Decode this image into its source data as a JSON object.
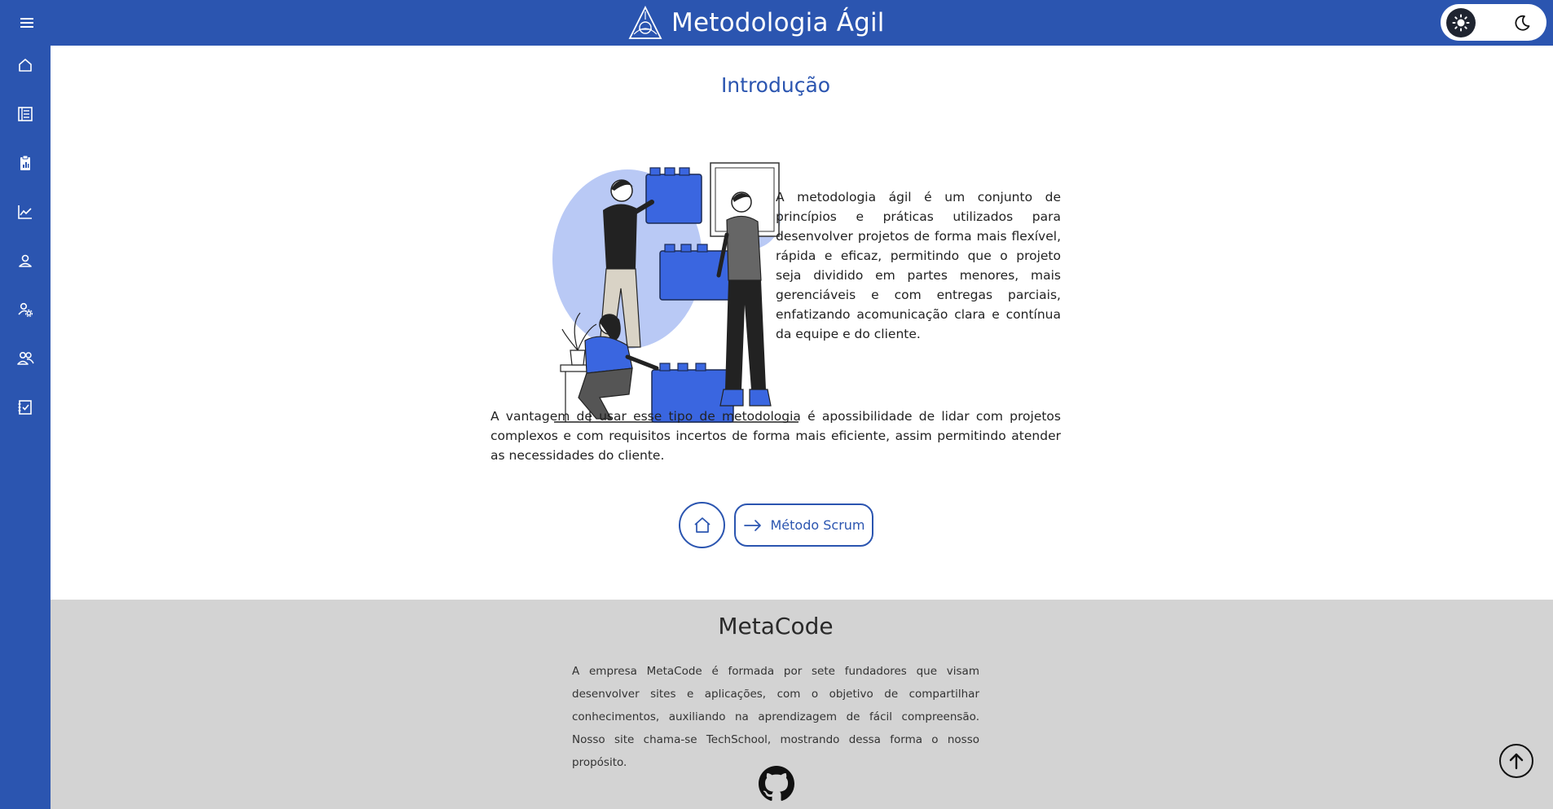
{
  "header": {
    "title": "Metodologia Ágil",
    "logo_icon": "triangle-logo-icon",
    "menu_icon": "hamburger-icon",
    "theme": {
      "light_icon": "sun-icon",
      "dark_icon": "moon-icon",
      "selected": "light"
    }
  },
  "sidebar": {
    "items": [
      {
        "icon": "home-icon"
      },
      {
        "icon": "list-document-icon"
      },
      {
        "icon": "clipboard-chart-icon"
      },
      {
        "icon": "line-chart-icon"
      },
      {
        "icon": "user-icon"
      },
      {
        "icon": "user-settings-icon"
      },
      {
        "icon": "users-icon"
      },
      {
        "icon": "checklist-icon"
      }
    ]
  },
  "main": {
    "section_title": "Introdução",
    "intro_text": "A metodologia ágil é um conjunto de princípios e práticas utilizados para desenvolver projetos de forma mais flexível, rápida e eficaz, permitindo que o projeto seja dividido em partes menores, mais gerenciáveis e com entregas parciais, enfatizando acomunicação clara e contínua da equipe e do cliente.",
    "advantage_text": "A vantagem de usar esse tipo de metodologia é apossibilidade de lidar com projetos complexos e com requisitos incertos de forma mais eficiente, assim permitindo atender as necessidades do cliente.",
    "illustration": "team-building-blocks-illustration",
    "home_button_icon": "home-icon",
    "next_button_label": "Método Scrum",
    "next_button_icon": "arrow-right-icon"
  },
  "footer": {
    "title": "MetaCode",
    "text": "A empresa MetaCode é formada por sete fundadores que visam desenvolver sites e aplicações, com o objetivo de compartilhar conhecimentos, auxiliando na aprendizagem de fácil compreensão. Nosso site chama-se TechSchool, mostrando dessa forma o nosso propósito.",
    "github_icon": "github-icon"
  },
  "scroll_top_icon": "arrow-up-circle-icon",
  "colors": {
    "primary": "#2b55b0",
    "illustration_blue": "#3a66e0",
    "illustration_light": "#b9c9f5",
    "footer_bg": "#d3d3d3"
  }
}
